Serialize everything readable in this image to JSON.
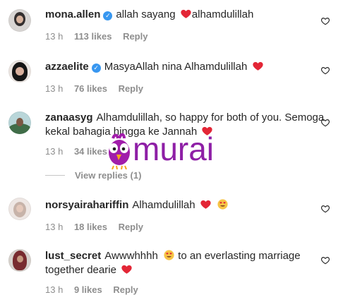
{
  "comments": [
    {
      "username": "mona.allen",
      "verified": true,
      "text_before": "allah sayang",
      "text_after": "alhamdulillah",
      "time": "13 h",
      "likes": "113 likes",
      "reply": "Reply",
      "icons": [
        "verified-icon",
        "heart-emoji",
        "heart-outline-icon"
      ]
    },
    {
      "username": "azzaelite",
      "verified": true,
      "text": "MasyaAllah nina Alhamdulillah",
      "time": "13 h",
      "likes": "76 likes",
      "reply": "Reply",
      "icons": [
        "verified-icon",
        "heart-emoji",
        "heart-outline-icon"
      ]
    },
    {
      "username": "zanaasyg",
      "verified": false,
      "text_line1": "Alhamdulillah, so happy for both of you. Semoga",
      "text_line2": "kekal bahagia hingga ke Jannah",
      "time": "13 h",
      "likes": "34 likes",
      "view_replies": "View replies (1)",
      "icons": [
        "heart-emoji",
        "heart-outline-icon"
      ]
    },
    {
      "username": "norsyairahariffin",
      "verified": false,
      "text": "Alhamdulillah",
      "time": "13 h",
      "likes": "18 likes",
      "reply": "Reply",
      "icons": [
        "heart-emoji",
        "heart-eyes-emoji",
        "heart-outline-icon"
      ]
    },
    {
      "username": "lust_secret",
      "verified": false,
      "text_line1_before": "Awwwhhhh",
      "text_line1_after": "to an everlasting marriage",
      "text_line2": "together dearie",
      "time": "13 h",
      "likes": "9 likes",
      "reply": "Reply",
      "icons": [
        "heart-eyes-emoji",
        "heart-emoji",
        "heart-outline-icon"
      ]
    }
  ],
  "watermark": {
    "text": "murai",
    "mascot": "purple-bird-logo"
  },
  "colors": {
    "text": "#262626",
    "secondary": "#8e8e8e",
    "verified": "#3897f0",
    "heart": "#e32636",
    "watermark": "#8e1fa6"
  }
}
